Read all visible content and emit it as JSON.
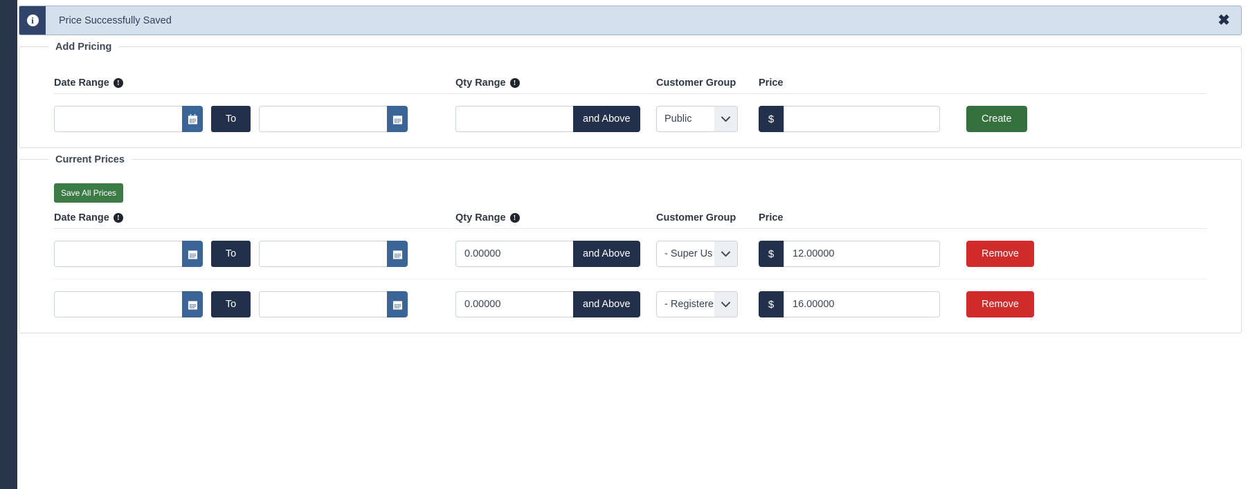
{
  "alert": {
    "icon": "info-icon",
    "message": "Price Successfully Saved",
    "close_label": "✖"
  },
  "add_pricing": {
    "legend": "Add Pricing",
    "headers": {
      "date_range": "Date Range",
      "qty_range": "Qty Range",
      "customer_group": "Customer Group",
      "price": "Price"
    },
    "row": {
      "date_from": "",
      "date_from_placeholder": "",
      "to_label": "To",
      "date_to": "",
      "date_to_placeholder": "",
      "qty": "",
      "qty_placeholder": "",
      "and_above_label": "and Above",
      "customer_group": "Public",
      "currency_symbol": "$",
      "price": "",
      "price_placeholder": ""
    },
    "create_label": "Create"
  },
  "current_prices": {
    "legend": "Current Prices",
    "save_all_label": "Save All Prices",
    "headers": {
      "date_range": "Date Range",
      "qty_range": "Qty Range",
      "customer_group": "Customer Group",
      "price": "Price"
    },
    "to_label": "To",
    "and_above_label": "and Above",
    "currency_symbol": "$",
    "remove_label": "Remove",
    "rows": [
      {
        "date_from": "",
        "date_to": "",
        "qty": "0.00000",
        "customer_group": "- Super Us",
        "price": "12.00000"
      },
      {
        "date_from": "",
        "date_to": "",
        "qty": "0.00000",
        "customer_group": "- Registere",
        "price": "16.00000"
      }
    ]
  },
  "colors": {
    "rail": "#273449",
    "alert_bg": "#d4e0ec",
    "dark_navy": "#22304b",
    "calendar_blue": "#3b6597",
    "green": "#35713f",
    "red": "#d12b2b"
  }
}
